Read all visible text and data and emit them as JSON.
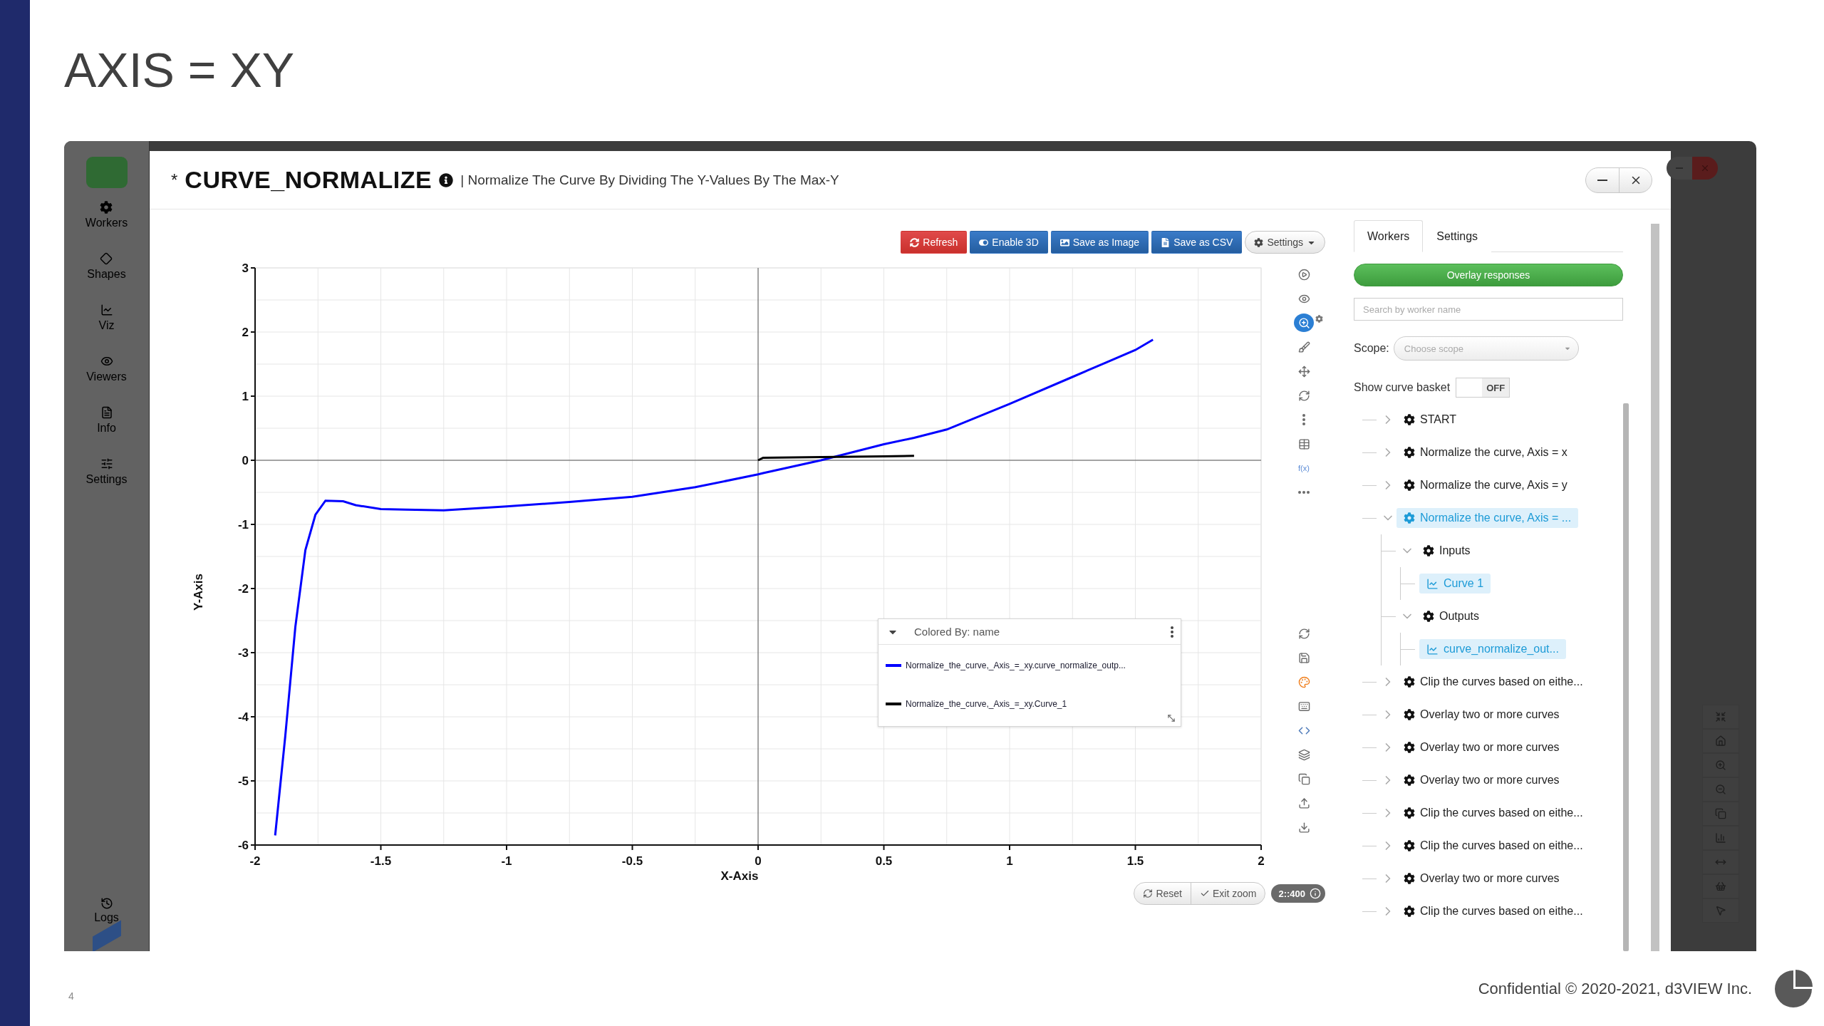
{
  "slide": {
    "title": "AXIS = XY",
    "page_number": "4",
    "footer": "Confidential © 2020-2021, d3VIEW Inc."
  },
  "app_sidebar": {
    "items": [
      {
        "kind": "workers",
        "label": "Workers"
      },
      {
        "kind": "shapes",
        "label": "Shapes"
      },
      {
        "kind": "viz",
        "label": "Viz"
      },
      {
        "kind": "viewers",
        "label": "Viewers"
      },
      {
        "kind": "info",
        "label": "Info"
      },
      {
        "kind": "settings",
        "label": "Settings"
      }
    ],
    "bottom_item": "Logs"
  },
  "modal": {
    "marker": "*",
    "title": "CURVE_NORMALIZE",
    "description": "| Normalize The Curve By Dividing The Y-Values By The Max-Y"
  },
  "chart_toolbar": [
    {
      "kind": "refresh",
      "label": "Refresh"
    },
    {
      "kind": "toggle",
      "label": "Enable 3D"
    },
    {
      "kind": "image",
      "label": "Save as Image"
    },
    {
      "kind": "csv",
      "label": "Save as CSV"
    },
    {
      "kind": "settings",
      "label": "Settings"
    }
  ],
  "chart": {
    "chart_data": {
      "type": "line",
      "xlabel": "X-Axis",
      "ylabel": "Y-Axis",
      "grid": true,
      "x": [
        -1.92,
        -1.88,
        -1.84,
        -1.8,
        -1.76,
        -1.72,
        -1.65,
        -1.6,
        -1.5,
        -1.4,
        -1.25,
        -1,
        -0.75,
        -0.5,
        -0.25,
        0,
        0.02,
        0.25,
        0.5,
        0.62,
        0.75,
        1,
        1.25,
        1.5,
        1.57
      ],
      "series": [
        {
          "name": "Normalize_the_curve,_Axis_=_xy.curve_normalize_outp...",
          "color": "#0000ff",
          "values": [
            -5.85,
            -4.3,
            -2.6,
            -1.4,
            -0.85,
            -0.63,
            -0.64,
            -0.7,
            -0.76,
            -0.77,
            -0.78,
            -0.72,
            -0.65,
            -0.57,
            -0.42,
            -0.22,
            -0.2,
            0.0,
            0.25,
            0.35,
            0.48,
            0.88,
            1.3,
            1.72,
            1.88
          ]
        },
        {
          "name": "Normalize_the_curve,_Axis_=_xy.Curve_1",
          "color": "#000000",
          "values": [
            null,
            null,
            null,
            null,
            null,
            null,
            null,
            null,
            null,
            null,
            null,
            null,
            null,
            null,
            null,
            0.0,
            0.04,
            0.05,
            0.06,
            0.07,
            null,
            null,
            null,
            null,
            null
          ]
        }
      ],
      "xlim": [
        -2,
        2
      ],
      "ylim": [
        -6,
        3
      ],
      "xticks": [
        -2,
        -1.5,
        -1,
        -0.5,
        0,
        0.5,
        1,
        1.5,
        2
      ],
      "yticks": [
        -6,
        -5,
        -4,
        -3,
        -2,
        -1,
        0,
        1,
        2,
        3
      ]
    }
  },
  "legend": {
    "title": "Colored By: name"
  },
  "tools": {
    "upper": [
      {
        "kind": "play",
        "selected": false
      },
      {
        "kind": "eye",
        "selected": false
      },
      {
        "kind": "zoom",
        "selected": true
      },
      {
        "kind": "brush",
        "selected": false
      },
      {
        "kind": "move",
        "selected": false
      },
      {
        "kind": "refresh",
        "selected": false
      },
      {
        "kind": "more_vertical",
        "selected": false
      },
      {
        "kind": "table",
        "selected": false
      },
      {
        "kind": "function",
        "label": "f(x)",
        "selected": false
      },
      {
        "kind": "more",
        "selected": false
      }
    ],
    "lower": [
      {
        "kind": "refresh",
        "selected": false
      },
      {
        "kind": "save",
        "selected": false
      },
      {
        "kind": "palette",
        "selected": false
      },
      {
        "kind": "keyboard",
        "selected": false
      },
      {
        "kind": "code",
        "selected": false
      },
      {
        "kind": "layers",
        "selected": false
      },
      {
        "kind": "copy",
        "selected": false
      },
      {
        "kind": "upload",
        "selected": false
      },
      {
        "kind": "download",
        "selected": false
      }
    ]
  },
  "zoom_controls": {
    "reset": "Reset",
    "exit": "Exit zoom",
    "badge": "2::400"
  },
  "panel": {
    "tabs": [
      {
        "label": "Workers",
        "selected": true
      },
      {
        "label": "Settings",
        "selected": false
      }
    ],
    "overlay_button": "Overlay responses",
    "search": {
      "placeholder": "Search by worker name"
    },
    "scope": {
      "label": "Scope:",
      "placeholder": "Choose scope"
    },
    "basket": {
      "label": "Show curve basket",
      "toggle": {
        "on": false,
        "label": "OFF"
      }
    },
    "tree": [
      {
        "kind": "worker",
        "label": "START",
        "expanded": false,
        "selected": false
      },
      {
        "kind": "worker",
        "label": "Normalize the curve, Axis = x",
        "expanded": false,
        "selected": false
      },
      {
        "kind": "worker",
        "label": "Normalize the curve, Axis = y",
        "expanded": false,
        "selected": false
      },
      {
        "kind": "worker",
        "label": "Normalize the curve, Axis = ...",
        "expanded": true,
        "selected": true,
        "children": [
          {
            "kind": "group",
            "label": "Inputs",
            "expanded": true,
            "selected": false,
            "children": [
              {
                "kind": "curve",
                "label": "Curve 1",
                "selected": true
              }
            ]
          },
          {
            "kind": "group",
            "label": "Outputs",
            "expanded": true,
            "selected": false,
            "children": [
              {
                "kind": "curve",
                "label": "curve_normalize_out...",
                "selected": true
              }
            ]
          }
        ]
      },
      {
        "kind": "worker",
        "label": "Clip the curves based on eithe...",
        "expanded": false,
        "selected": false
      },
      {
        "kind": "worker",
        "label": "Overlay two or more curves",
        "expanded": false,
        "selected": false
      },
      {
        "kind": "worker",
        "label": "Overlay two or more curves",
        "expanded": false,
        "selected": false
      },
      {
        "kind": "worker",
        "label": "Overlay two or more curves",
        "expanded": false,
        "selected": false
      },
      {
        "kind": "worker",
        "label": "Clip the curves based on eithe...",
        "expanded": false,
        "selected": false
      },
      {
        "kind": "worker",
        "label": "Clip the curves based on eithe...",
        "expanded": false,
        "selected": false
      },
      {
        "kind": "worker",
        "label": "Overlay two or more curves",
        "expanded": false,
        "selected": false
      },
      {
        "kind": "worker",
        "label": "Clip the curves based on eithe...",
        "expanded": false,
        "selected": false
      }
    ]
  }
}
